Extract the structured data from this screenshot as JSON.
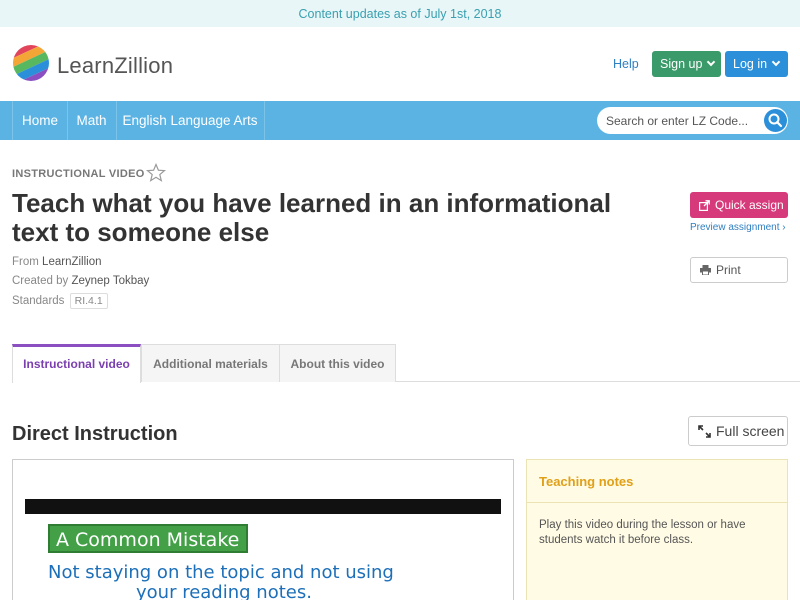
{
  "banner": {
    "text": "Content updates as of July 1st, 2018"
  },
  "header": {
    "brand": "LearnZillion",
    "help": "Help",
    "signup": "Sign up",
    "login": "Log in",
    "logo_colors": [
      "#e2445c",
      "#f3a536",
      "#58b85f",
      "#2b90d9",
      "#8b4fc1"
    ]
  },
  "nav": {
    "items": [
      "Home",
      "Math",
      "English Language Arts"
    ],
    "search_placeholder": "Search or enter LZ Code..."
  },
  "lesson": {
    "type_label": "INSTRUCTIONAL VIDEO",
    "title": "Teach what you have learned in an informational text to someone else",
    "from_label": "From",
    "from_value": "LearnZillion",
    "created_label": "Created by",
    "created_value": "Zeynep Tokbay",
    "standards_label": "Standards",
    "standards_value": "RI.4.1"
  },
  "actions": {
    "quick_assign": "Quick assign",
    "preview": "Preview assignment ›",
    "print": "Print"
  },
  "tabs": [
    "Instructional video",
    "Additional materials",
    "About this video"
  ],
  "content": {
    "section_title": "Direct Instruction",
    "fullscreen": "Full screen",
    "video_label": "A Common Mistake",
    "video_line1": "Not staying on the topic and not using",
    "video_line2": "your reading notes."
  },
  "notes": {
    "heading": "Teaching notes",
    "body": "Play this video during the lesson or have students watch it before class."
  },
  "colors": {
    "nav": "#5bb3e3",
    "signup": "#3a9a6a",
    "login": "#2b90d9",
    "quick_assign": "#d63a7a",
    "tab_active": "#8b4fc1",
    "notes_heading": "#e0a018"
  }
}
